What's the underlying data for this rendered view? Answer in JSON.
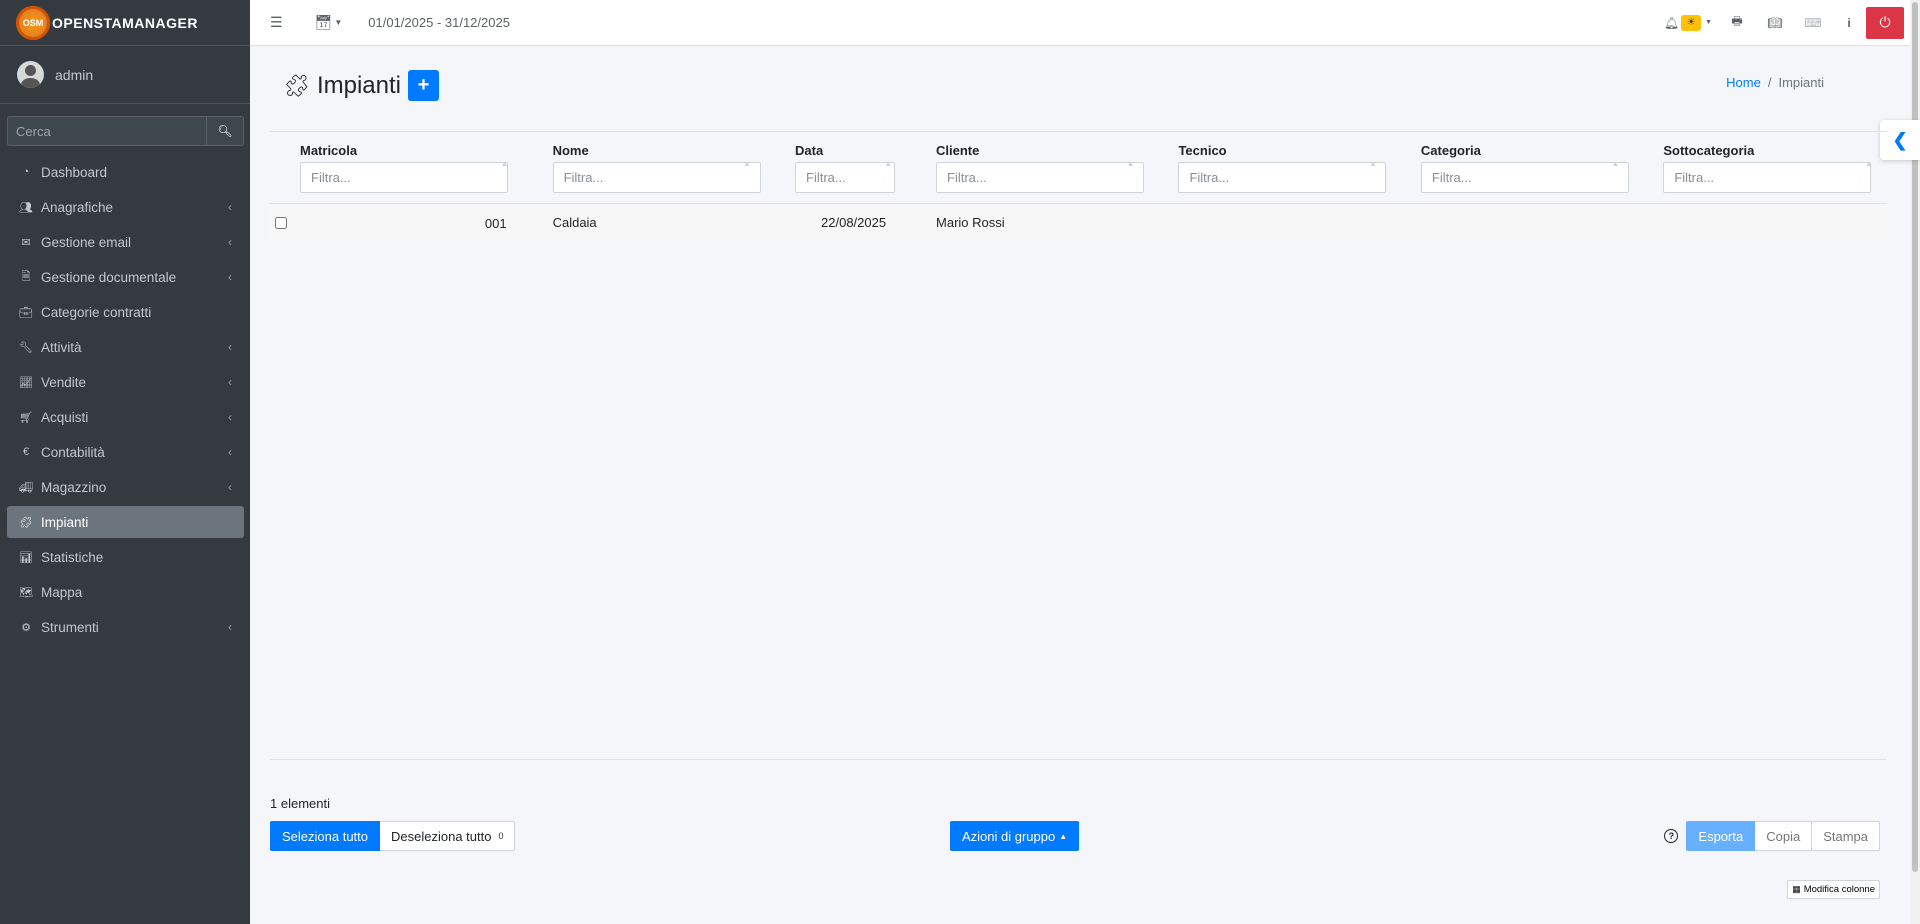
{
  "brand": {
    "logo_text": "OSM",
    "name": "OPENSTAMANAGER"
  },
  "user": {
    "name": "admin"
  },
  "sidebar": {
    "search_placeholder": "Cerca",
    "items": [
      {
        "label": "Dashboard",
        "icon": "tachometer-icon",
        "glyph": "◔",
        "submenu": false,
        "active": false
      },
      {
        "label": "Anagrafiche",
        "icon": "users-icon",
        "glyph": "👥",
        "submenu": true,
        "active": false
      },
      {
        "label": "Gestione email",
        "icon": "envelope-icon",
        "glyph": "✉",
        "submenu": true,
        "active": false
      },
      {
        "label": "Gestione documentale",
        "icon": "file-icon",
        "glyph": "🗎",
        "submenu": true,
        "active": false
      },
      {
        "label": "Categorie contratti",
        "icon": "briefcase-icon",
        "glyph": "💼",
        "submenu": false,
        "active": false
      },
      {
        "label": "Attività",
        "icon": "wrench-icon",
        "glyph": "🔧",
        "submenu": true,
        "active": false
      },
      {
        "label": "Vendite",
        "icon": "line-chart-icon",
        "glyph": "📈",
        "submenu": true,
        "active": false
      },
      {
        "label": "Acquisti",
        "icon": "shopping-cart-icon",
        "glyph": "🛒",
        "submenu": true,
        "active": false
      },
      {
        "label": "Contabilità",
        "icon": "euro-icon",
        "glyph": "€",
        "submenu": true,
        "active": false
      },
      {
        "label": "Magazzino",
        "icon": "truck-icon",
        "glyph": "🚚",
        "submenu": true,
        "active": false
      },
      {
        "label": "Impianti",
        "icon": "puzzle-icon",
        "glyph": "🧩",
        "submenu": false,
        "active": true
      },
      {
        "label": "Statistiche",
        "icon": "bar-chart-icon",
        "glyph": "📊",
        "submenu": false,
        "active": false
      },
      {
        "label": "Mappa",
        "icon": "map-icon",
        "glyph": "🗺",
        "submenu": false,
        "active": false
      },
      {
        "label": "Strumenti",
        "icon": "cog-icon",
        "glyph": "⚙",
        "submenu": true,
        "active": false
      }
    ]
  },
  "topbar": {
    "date_range": "01/01/2025 - 31/12/2025"
  },
  "page": {
    "title": "Impianti",
    "breadcrumb": {
      "home": "Home",
      "current": "Impianti"
    }
  },
  "table": {
    "filter_placeholder": "Filtra...",
    "columns": [
      "Matricola",
      "Nome",
      "Data",
      "Cliente",
      "Tecnico",
      "Categoria",
      "Sottocategoria"
    ],
    "rows": [
      {
        "matricola": "001",
        "nome": "Caldaia",
        "data": "22/08/2025",
        "cliente": "Mario Rossi",
        "tecnico": "",
        "categoria": "",
        "sottocategoria": ""
      }
    ]
  },
  "footer": {
    "count": "1 elementi",
    "select_all": "Seleziona tutto",
    "deselect_all": "Deseleziona tutto",
    "selected_count": "0",
    "bulk_actions": "Azioni di gruppo",
    "export": "Esporta",
    "copy": "Copia",
    "print": "Stampa",
    "edit_columns": "Modifica colonne"
  },
  "colors": {
    "primary": "#007bff",
    "sidebar_bg": "#343a40",
    "danger": "#dc3545",
    "warning": "#ffc107"
  }
}
